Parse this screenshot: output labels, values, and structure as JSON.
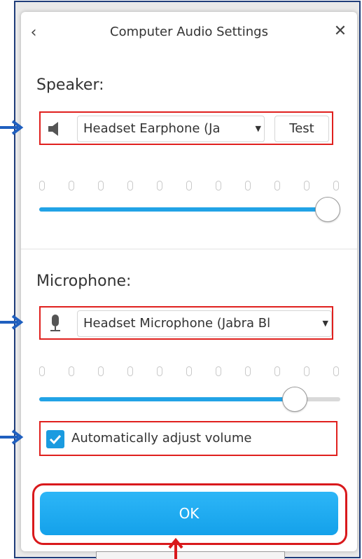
{
  "dialog": {
    "title": "Computer Audio Settings",
    "back_icon": "chevron-left-icon",
    "close_icon": "close-icon"
  },
  "speaker": {
    "label": "Speaker:",
    "icon": "speaker-icon",
    "device": "Headset Earphone (Ja",
    "test_label": "Test",
    "volume": 1.0
  },
  "microphone": {
    "label": "Microphone:",
    "icon": "microphone-icon",
    "device": "Headset Microphone (Jabra Bl",
    "volume": 0.88
  },
  "auto_adjust": {
    "label": "Automatically adjust volume",
    "checked": true
  },
  "ok_label": "OK",
  "colors": {
    "accent": "#1a9be0",
    "annotation_red": "#e0201e",
    "annotation_arrow": "#1f5fbf"
  }
}
